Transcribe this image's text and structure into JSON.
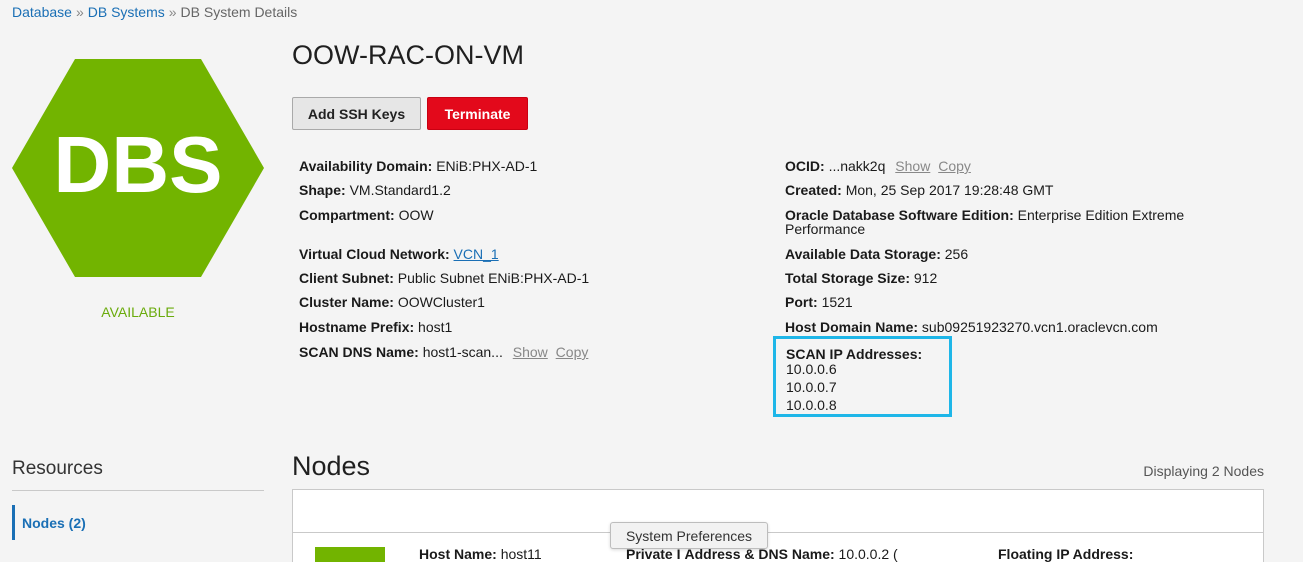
{
  "breadcrumb": {
    "items": [
      "Database",
      "DB Systems",
      "DB System Details"
    ],
    "separator": "»"
  },
  "hero": {
    "icon_text": "DBS",
    "status": "AVAILABLE",
    "color": "#6aab0c"
  },
  "title": "OOW-RAC-ON-VM",
  "actions": {
    "add_ssh_keys": "Add SSH Keys",
    "terminate": "Terminate"
  },
  "details_left": [
    {
      "label": "Availability Domain:",
      "value": "ENiB:PHX-AD-1"
    },
    {
      "label": "Shape:",
      "value": "VM.Standard1.2"
    },
    {
      "label": "Compartment:",
      "value": "OOW"
    },
    {
      "label": "Virtual Cloud Network:",
      "value": "VCN_1"
    },
    {
      "label": "Client Subnet:",
      "value": "Public Subnet ENiB:PHX-AD-1"
    },
    {
      "label": "Cluster Name:",
      "value": "OOWCluster1"
    },
    {
      "label": "Hostname Prefix:",
      "value": "host1"
    },
    {
      "label": "SCAN DNS Name:",
      "value": "host1-scan...",
      "show": "Show",
      "copy": "Copy"
    }
  ],
  "details_right": [
    {
      "label": "OCID:",
      "value": "...nakk2q",
      "show": "Show",
      "copy": "Copy"
    },
    {
      "label": "Created:",
      "value": "Mon, 25 Sep 2017 19:28:48 GMT"
    },
    {
      "label": "Oracle Database Software Edition:",
      "value": "Enterprise Edition Extreme",
      "value2": "Performance"
    },
    {
      "label": "Available Data Storage:",
      "value": "256"
    },
    {
      "label": "Total Storage Size:",
      "value": "912"
    },
    {
      "label": "Port:",
      "value": "1521"
    },
    {
      "label": "Host Domain Name:",
      "value": "sub09251923270.vcn1.oraclevcn.com"
    }
  ],
  "scan_ips": {
    "label": "SCAN IP Addresses:",
    "addresses": [
      "10.0.0.6",
      "10.0.0.7",
      "10.0.0.8"
    ]
  },
  "resources": {
    "title": "Resources",
    "items": [
      {
        "label": "Nodes (2)"
      }
    ]
  },
  "nodes": {
    "title": "Nodes",
    "count_text": "Displaying 2 Nodes",
    "row": {
      "host_label": "Host Name:",
      "host_value": "host11",
      "private_label": "Private I",
      "private_rest": "Address & DNS Name:",
      "private_value": "10.0.0.2 (",
      "floating_label": "Floating IP Address:"
    }
  },
  "tooltip": "System Preferences"
}
